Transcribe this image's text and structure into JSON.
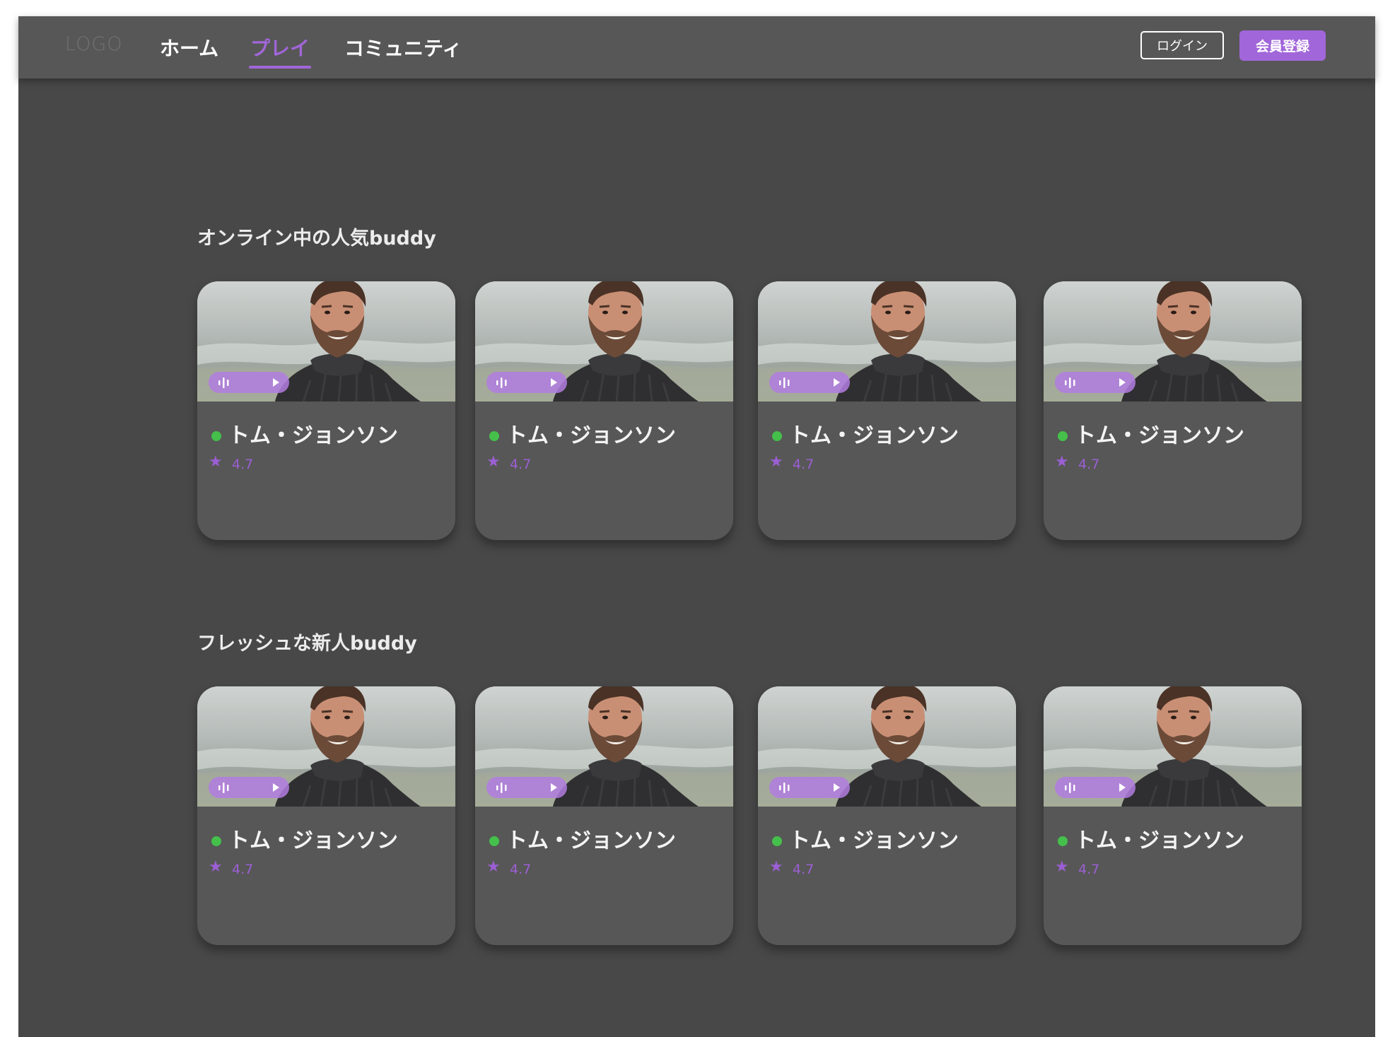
{
  "nav": {
    "logo": "LOGO",
    "links": [
      {
        "label": "ホーム",
        "active": false
      },
      {
        "label": "プレイ",
        "active": true
      },
      {
        "label": "コミュニティ",
        "active": false
      }
    ],
    "login_label": "ログイン",
    "register_label": "会員登録"
  },
  "colors": {
    "accent": "#a166d9",
    "online": "#44c04b",
    "background": "#484848",
    "navbar": "#575757",
    "card": "#575757"
  },
  "sections": [
    {
      "title": "オンライン中の人気buddy",
      "cards": [
        {
          "name": "トム・ジョンソン",
          "rating": "4.7",
          "online": true
        },
        {
          "name": "トム・ジョンソン",
          "rating": "4.7",
          "online": true
        },
        {
          "name": "トム・ジョンソン",
          "rating": "4.7",
          "online": true
        },
        {
          "name": "トム・ジョンソン",
          "rating": "4.7",
          "online": true
        }
      ]
    },
    {
      "title": "フレッシュな新人buddy",
      "cards": [
        {
          "name": "トム・ジョンソン",
          "rating": "4.7",
          "online": true
        },
        {
          "name": "トム・ジョンソン",
          "rating": "4.7",
          "online": true
        },
        {
          "name": "トム・ジョンソン",
          "rating": "4.7",
          "online": true
        },
        {
          "name": "トム・ジョンソン",
          "rating": "4.7",
          "online": true
        }
      ]
    }
  ],
  "icons": {
    "rating": "star-icon",
    "voice": "voice-wave-icon",
    "play": "play-icon",
    "status": "online-status-icon"
  }
}
